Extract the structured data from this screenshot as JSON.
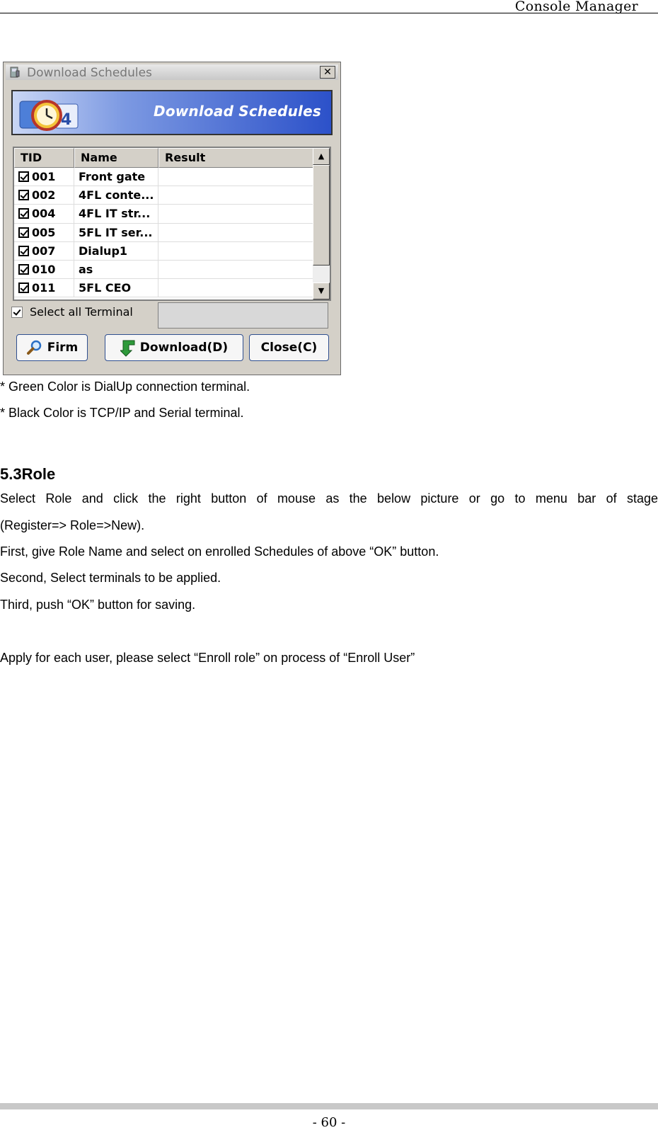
{
  "header": {
    "title": "Console Manager"
  },
  "dialog": {
    "title": "Download Schedules",
    "close_glyph": "✕",
    "banner_text": "Download Schedules",
    "columns": [
      "TID",
      "Name",
      "Result"
    ],
    "rows": [
      {
        "tid": "001",
        "name": "Front gate",
        "result": ""
      },
      {
        "tid": "002",
        "name": "4FL conte...",
        "result": ""
      },
      {
        "tid": "004",
        "name": "4FL IT str...",
        "result": ""
      },
      {
        "tid": "005",
        "name": "5FL IT ser...",
        "result": ""
      },
      {
        "tid": "007",
        "name": "Dialup1",
        "result": ""
      },
      {
        "tid": "010",
        "name": "as",
        "result": ""
      },
      {
        "tid": "011",
        "name": "5FL CEO",
        "result": ""
      }
    ],
    "select_all_label": "Select all Terminal",
    "buttons": {
      "firm": "Firm",
      "download": "Download(D)",
      "close": "Close(C)"
    },
    "colors": {
      "banner_blue": "#2c51c9",
      "download_arrow": "#2e9a3a"
    }
  },
  "notes": [
    "* Green Color is DialUp connection terminal.",
    "* Black Color is TCP/IP and Serial terminal."
  ],
  "section": {
    "heading": "5.3Role",
    "paragraphs": [
      "Select Role and click the right button of mouse as the below picture or go to menu bar of stage",
      "(Register=> Role=>New).",
      "First, give Role Name and select on enrolled Schedules of above “OK” button.",
      "Second, Select terminals to be applied.",
      "Third, push “OK” button for saving."
    ],
    "apply_note": "Apply for each user, please select “Enroll role” on process of “Enroll User”"
  },
  "footer": {
    "page_number": "- 60 -"
  }
}
